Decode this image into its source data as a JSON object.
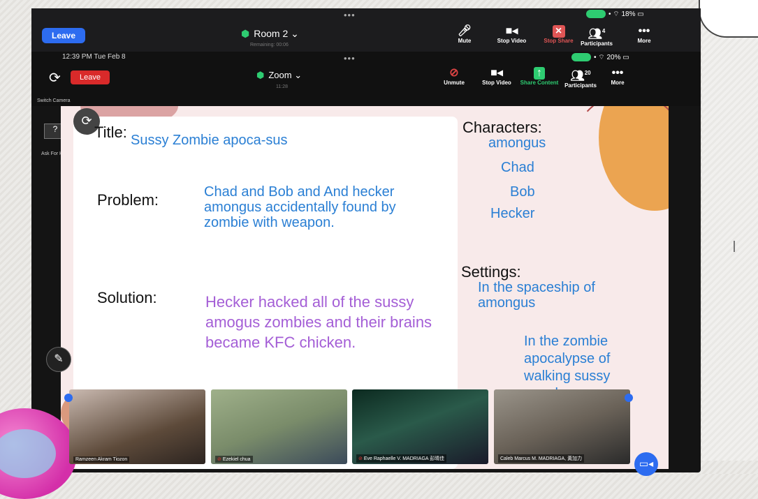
{
  "outer": {
    "leave": "Leave",
    "room": "Room 2",
    "remaining": "Remaining: 00:06",
    "tools": [
      {
        "icon": "mic-icon",
        "label": "Mute"
      },
      {
        "icon": "video-icon",
        "label": "Stop Video"
      },
      {
        "icon": "share-icon",
        "label": "Stop Share"
      },
      {
        "icon": "participants-icon",
        "label": "Participants",
        "count": "4"
      },
      {
        "icon": "more-icon",
        "label": "More"
      }
    ],
    "battery": "18%"
  },
  "inner": {
    "time": "12:39 PM  Tue Feb 8",
    "leave": "Leave",
    "meeting": "Zoom",
    "timer": "11:28",
    "switch_camera": "Switch Camera",
    "ask_for_help": "Ask For Help",
    "tools": [
      {
        "icon": "mic-muted-icon",
        "label": "Unmute"
      },
      {
        "icon": "video-icon",
        "label": "Stop Video"
      },
      {
        "icon": "share-icon",
        "label": "Share Content"
      },
      {
        "icon": "participants-icon",
        "label": "Participants",
        "count": "20"
      },
      {
        "icon": "more-icon",
        "label": "More"
      }
    ],
    "battery": "20%"
  },
  "slide": {
    "title_label": "Title:",
    "title": "Sussy Zombie apoca-sus",
    "problem_label": "Problem:",
    "problem": "Chad and Bob and And hecker amongus accidentally found by zombie with weapon.",
    "solution_label": "Solution:",
    "solution": "Hecker hacked all of the sussy amogus zombies and their brains became KFC chicken.",
    "characters_label": "Characters:",
    "characters": [
      "amongus",
      "Chad",
      "Bob",
      "Hecker"
    ],
    "settings_label": "Settings:",
    "settings_1": "In the spaceship of amongus",
    "settings_2": "In the zombie apocalypse of walking sussy people"
  },
  "participants": [
    {
      "name": "Ramzeen Akram Tiozon",
      "color": "#5d4a3a"
    },
    {
      "name": "Ezekiel chua",
      "color": "#7a8c6a"
    },
    {
      "name": "Eve Raphaelle V. MADRIAGA 彭晴佳",
      "color": "#2a5a4a"
    },
    {
      "name": "Caleb Marcus M. MADRIAGA, 黃加力",
      "color": "#6a6258"
    }
  ],
  "colors": {
    "accent": "#2d6cf0",
    "leave_red": "#d92a2a",
    "text_blue": "#2a7fd4",
    "text_purple": "#a45ed6"
  }
}
